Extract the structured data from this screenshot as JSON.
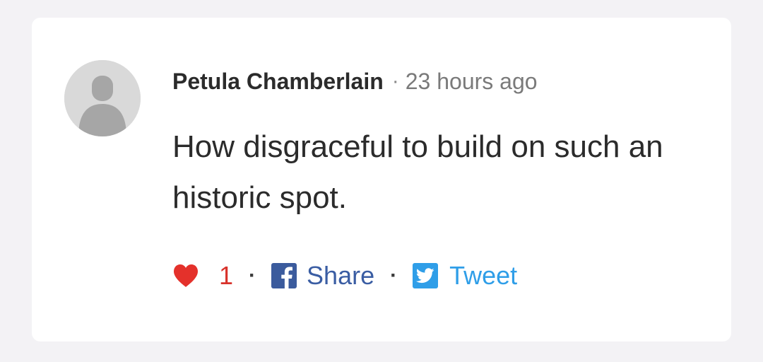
{
  "comment": {
    "author": "Petula Chamberlain",
    "separator": "·",
    "time": "23 hours ago",
    "text": "How disgraceful to build on such an historic spot."
  },
  "actions": {
    "like_count": "1",
    "separator": "·",
    "share_label": "Share",
    "tweet_label": "Tweet"
  },
  "icons": {
    "avatar": "user-avatar-placeholder",
    "like": "heart-icon",
    "share": "facebook-icon",
    "tweet": "twitter-icon"
  },
  "colors": {
    "like": "#d8322b",
    "facebook": "#3b5b9d",
    "twitter": "#2f9ee8"
  }
}
